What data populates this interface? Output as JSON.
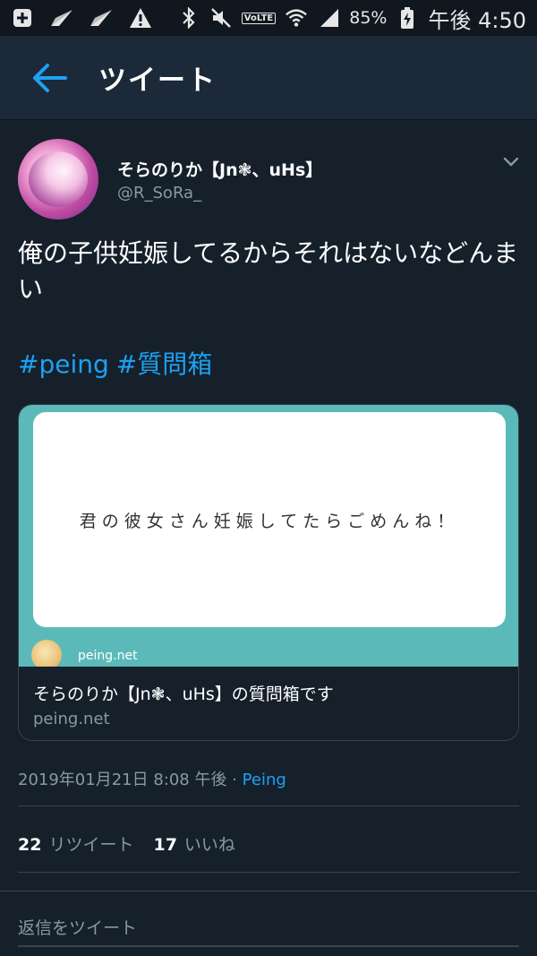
{
  "status_bar": {
    "battery": "85%",
    "time": "午後 4:50",
    "volte": "VoLTE",
    "icons": [
      "plus-box-icon",
      "send-icon",
      "send-icon",
      "warning-icon",
      "bluetooth-icon",
      "mute-icon",
      "volte-icon",
      "wifi-icon",
      "signal-icon",
      "battery-icon"
    ]
  },
  "header": {
    "title": "ツイート",
    "back_icon": "arrow-left-icon"
  },
  "tweet": {
    "name": "そらのりか【Jn❃、uHs】",
    "handle": "@R_SoRa_",
    "text": "俺の子供妊娠してるからそれはないなどんまい",
    "hashtags": [
      "#peing",
      "#質問箱"
    ],
    "card": {
      "question": "君の彼女さん妊娠してたらごめんね！",
      "site_label": "peing.net",
      "title": "そらのりか【Jn❃、uHs】の質問箱です",
      "domain": "peing.net"
    },
    "timestamp": "2019年01月21日 8:08 午後 · ",
    "source": "Peing",
    "retweets_count": "22",
    "retweets_label": "リツイート",
    "likes_count": "17",
    "likes_label": "いいね"
  },
  "reply": {
    "placeholder": "返信をツイート"
  },
  "colors": {
    "background": "#15202b",
    "header": "#1c2938",
    "accent": "#1da1f2",
    "muted": "#8899a6",
    "card_teal": "#5bbab9"
  }
}
